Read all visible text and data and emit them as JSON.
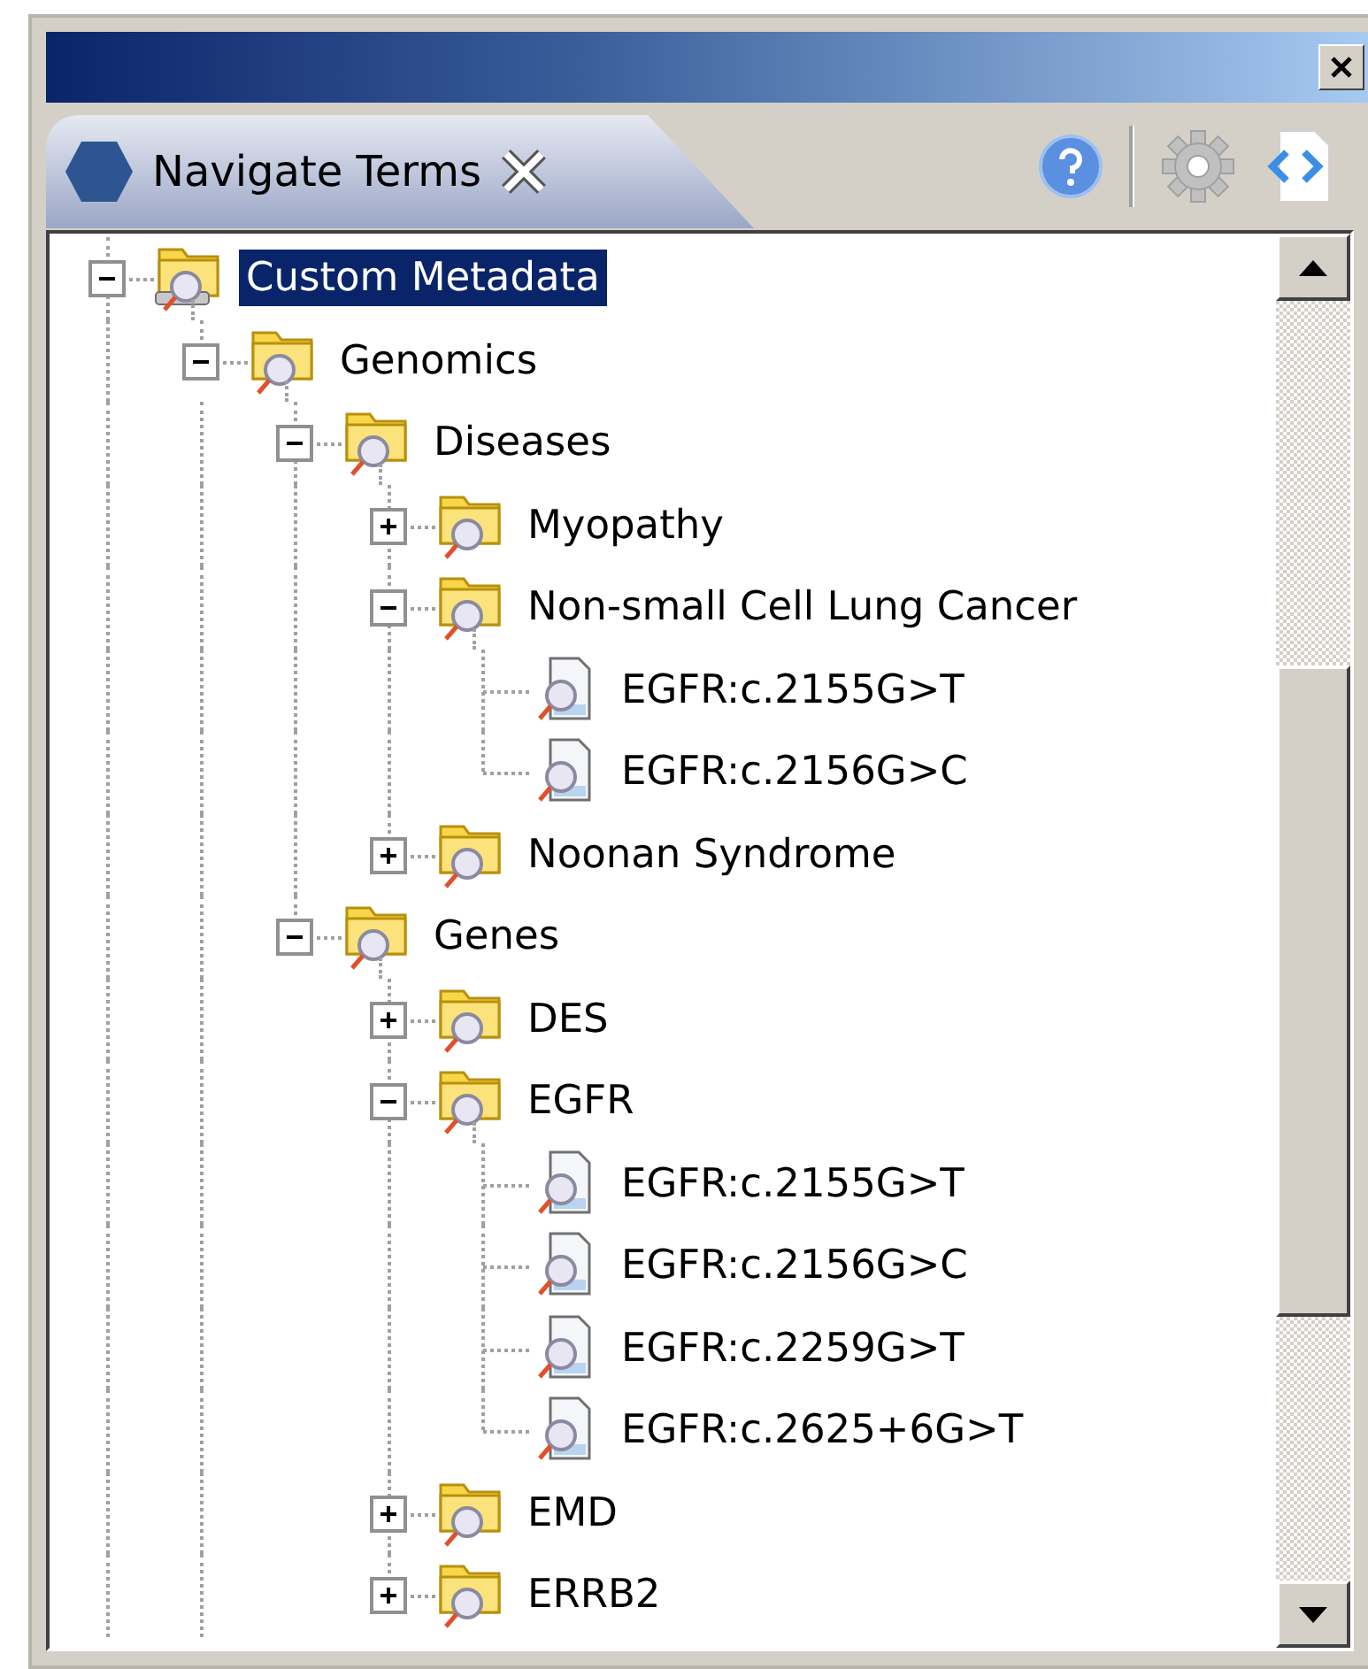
{
  "view": {
    "title": "Navigate Terms"
  },
  "tree": [
    {
      "label": "Custom Metadata",
      "kind": "root",
      "selected": true,
      "expanded": true,
      "children": [
        {
          "label": "Genomics",
          "kind": "folder",
          "selected": false,
          "expanded": true,
          "children": [
            {
              "label": "Diseases",
              "kind": "folder",
              "selected": false,
              "expanded": true,
              "children": [
                {
                  "label": "Myopathy",
                  "kind": "folder",
                  "selected": false,
                  "expanded": false
                },
                {
                  "label": "Non-small Cell Lung Cancer",
                  "kind": "folder",
                  "selected": false,
                  "expanded": true,
                  "children": [
                    {
                      "label": "EGFR:c.2155G>T",
                      "kind": "term",
                      "selected": false
                    },
                    {
                      "label": "EGFR:c.2156G>C",
                      "kind": "term",
                      "selected": false
                    }
                  ]
                },
                {
                  "label": "Noonan Syndrome",
                  "kind": "folder",
                  "selected": false,
                  "expanded": false
                }
              ]
            },
            {
              "label": "Genes",
              "kind": "folder",
              "selected": false,
              "expanded": true,
              "children": [
                {
                  "label": "DES",
                  "kind": "folder",
                  "selected": false,
                  "expanded": false
                },
                {
                  "label": "EGFR",
                  "kind": "folder",
                  "selected": false,
                  "expanded": true,
                  "children": [
                    {
                      "label": "EGFR:c.2155G>T",
                      "kind": "term",
                      "selected": false
                    },
                    {
                      "label": "EGFR:c.2156G>C",
                      "kind": "term",
                      "selected": false
                    },
                    {
                      "label": "EGFR:c.2259G>T",
                      "kind": "term",
                      "selected": false
                    },
                    {
                      "label": "EGFR:c.2625+6G>T",
                      "kind": "term",
                      "selected": false
                    }
                  ]
                },
                {
                  "label": "EMD",
                  "kind": "folder",
                  "selected": false,
                  "expanded": false
                },
                {
                  "label": "ERRB2",
                  "kind": "folder",
                  "selected": false,
                  "expanded": false
                }
              ]
            }
          ]
        }
      ]
    }
  ]
}
